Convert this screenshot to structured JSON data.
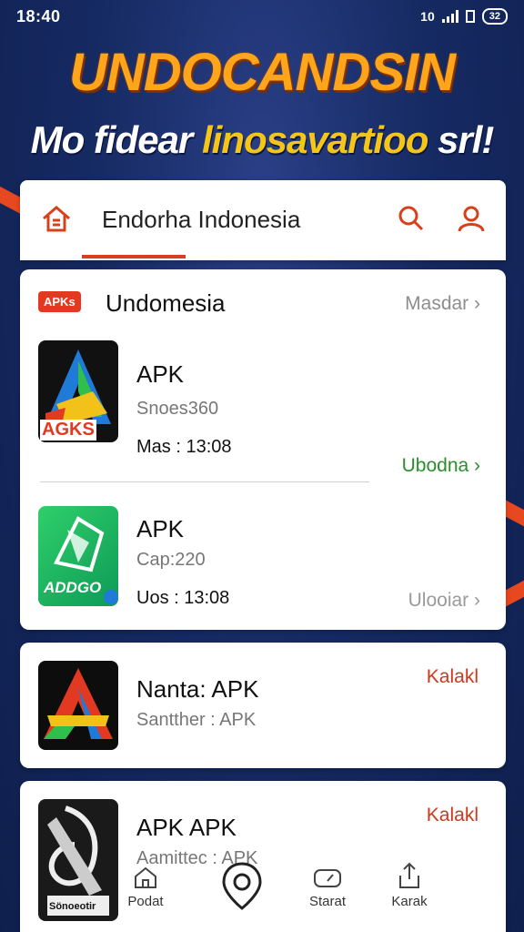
{
  "status": {
    "time": "18:40",
    "battery": "32",
    "network": "10"
  },
  "banner": {
    "title": "UNDOCANDSIN",
    "sub_a": "Mo fidear ",
    "sub_b": "linosavartioo",
    "sub_c": " srl!"
  },
  "header": {
    "title": "Endorha Indonesia"
  },
  "section": {
    "tag": "APKs",
    "title": "Undomesia",
    "more": "Masdar"
  },
  "apps": [
    {
      "name": "APK",
      "meta": "Snoes360",
      "date": "Mas : 13:08",
      "action": "Ubodna",
      "action_color": "#2a8f2a",
      "icon_text": "AGKS"
    },
    {
      "name": "APK",
      "meta": "Cap:220",
      "date": "Uos : 13:08",
      "action": "Ulooiar",
      "action_color": "#9a9a9a",
      "icon_text": "ADDGO"
    },
    {
      "name": "Nanta: APK",
      "meta": "Santther : APK",
      "action": "Kalakl",
      "action_color": "#c83a20"
    },
    {
      "name": "APK APK",
      "meta": "Aamittec : APK",
      "action": "Kalakl",
      "action_color": "#c83a20",
      "icon_text": "Sönoeotir"
    }
  ],
  "nav": [
    {
      "label": "Podat",
      "icon": "home-icon"
    },
    {
      "label": "",
      "icon": "location-pin-icon"
    },
    {
      "label": "Starat",
      "icon": "gauge-icon"
    },
    {
      "label": "Karak",
      "icon": "share-icon"
    }
  ],
  "colors": {
    "accent": "#e23a22",
    "banner_orange": "#ffa51c",
    "background": "#162a63"
  }
}
